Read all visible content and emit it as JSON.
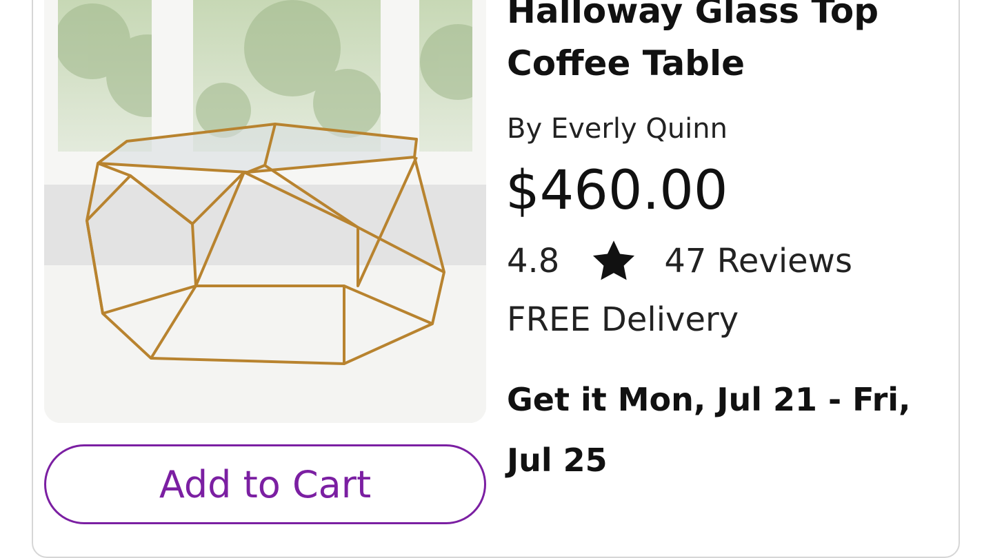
{
  "product": {
    "title": "Halloway Glass Top Coffee Table",
    "brand": "By Everly Quinn",
    "price": "$460.00",
    "rating": "4.8",
    "reviews": "47 Reviews",
    "delivery": "FREE Delivery",
    "delivery_estimate": "Get it Mon, Jul 21 - Fri, Jul 25",
    "add_to_cart_label": "Add to Cart",
    "image_alt": "glass top coffee table with gold geometric frame"
  },
  "colors": {
    "accent": "#7B1FA2",
    "text": "#111111",
    "card_border": "#D6D6D6",
    "frame_gold": "#B8832F"
  },
  "icons": {
    "rating": "star-icon"
  }
}
